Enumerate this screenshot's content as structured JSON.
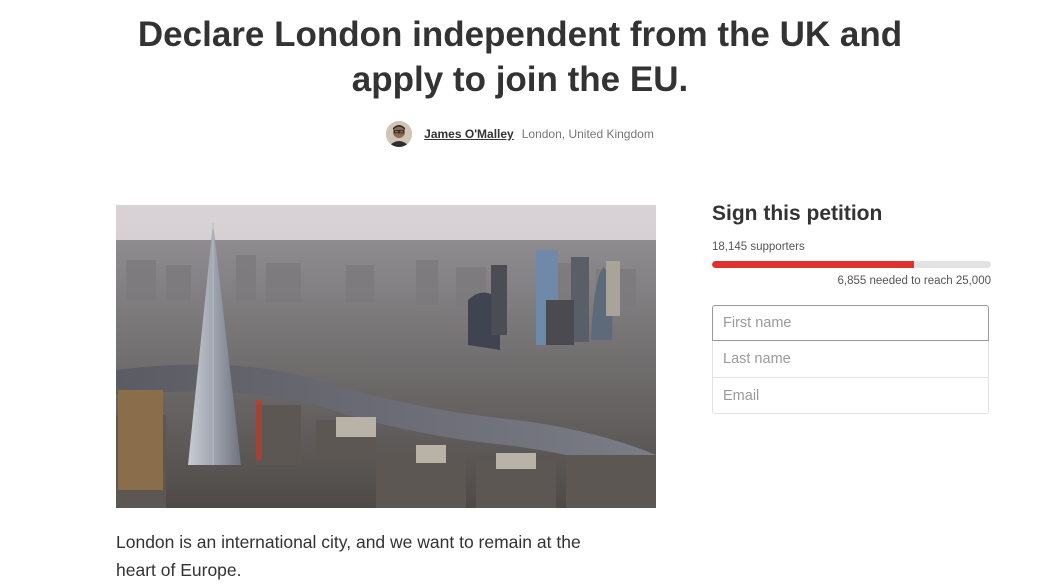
{
  "petition": {
    "title_line1": "Declare London independent from the UK and",
    "title_line2": "apply to join the EU.",
    "author_name": "James O'Malley",
    "author_location": "London, United Kingdom",
    "description_line1": "London is an international city, and we want to remain at the",
    "description_line2": "heart of Europe."
  },
  "sign": {
    "heading": "Sign this petition",
    "supporters_text": "18,145 supporters",
    "needed_text": "6,855 needed to reach 25,000",
    "progress_fraction": 0.7258,
    "progress_color": "#e0312d",
    "first_name_placeholder": "First name",
    "last_name_placeholder": "Last name",
    "email_placeholder": "Email"
  },
  "icons": {
    "avatar": "user-avatar-photo",
    "hero": "london-skyline-photo"
  }
}
